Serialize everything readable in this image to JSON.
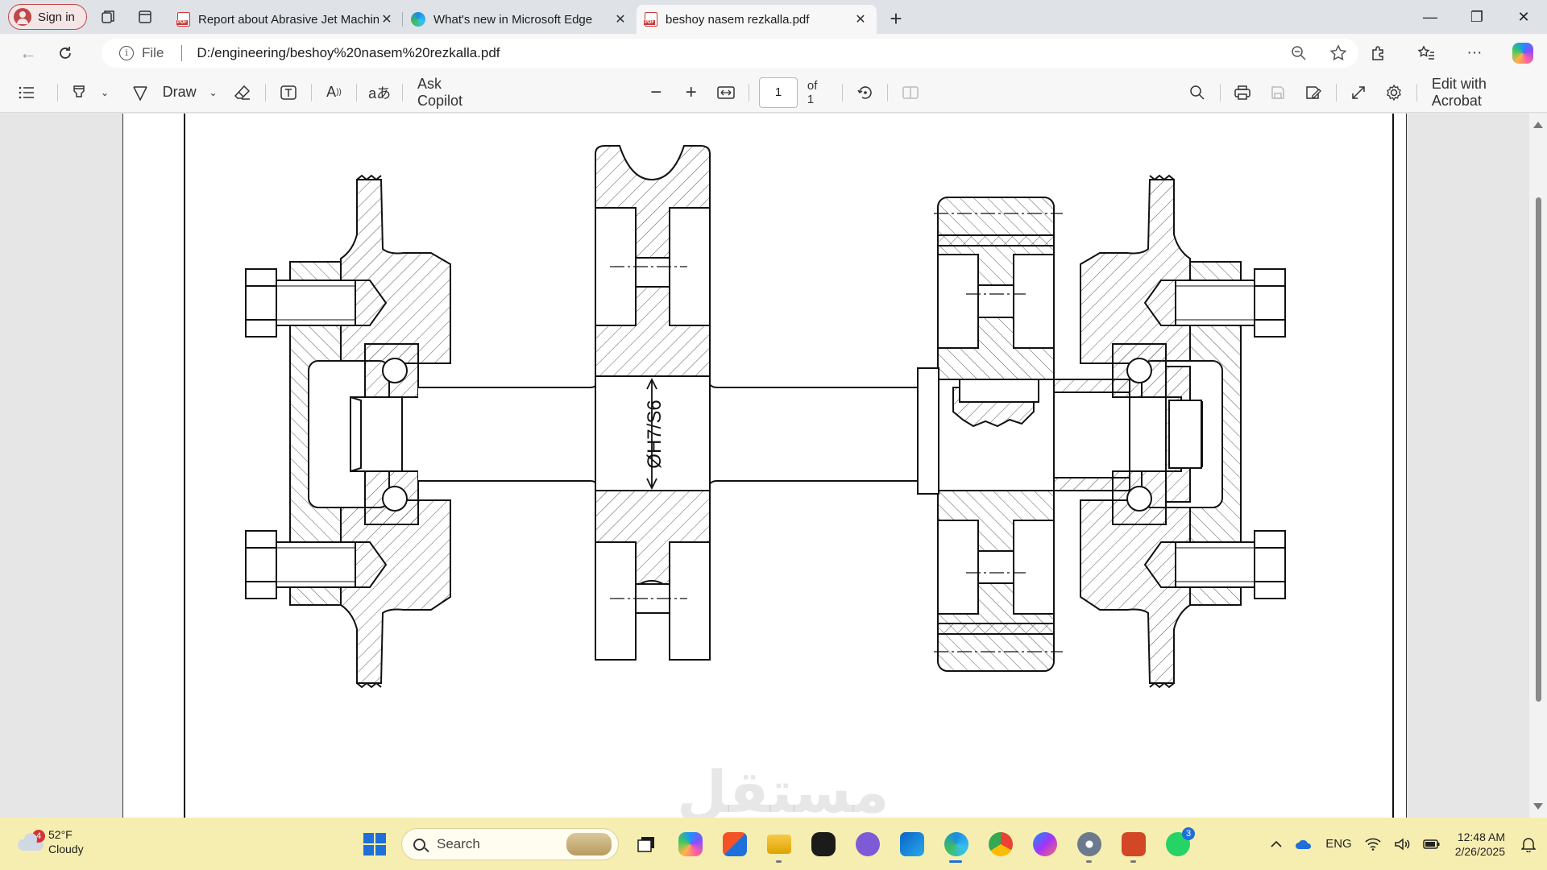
{
  "browser": {
    "sign_in": "Sign in",
    "tabs": [
      {
        "title": "Report about Abrasive Jet Machin",
        "icon": "pdf-icon"
      },
      {
        "title": "What's new in Microsoft Edge",
        "icon": "edge-icon"
      },
      {
        "title": "beshoy nasem rezkalla.pdf",
        "icon": "pdf-icon",
        "active": true
      }
    ],
    "address": {
      "scheme": "File",
      "url": "D:/engineering/beshoy%20nasem%20rezkalla.pdf"
    }
  },
  "pdf_toolbar": {
    "draw": "Draw",
    "ask_copilot": "Ask Copilot",
    "page_number": "1",
    "page_total": "of 1",
    "edit": "Edit with Acrobat"
  },
  "document": {
    "fit_label": "ØH7/S6",
    "watermark": "مستقل"
  },
  "taskbar": {
    "weather_temp": "52°F",
    "weather_cond": "Cloudy",
    "weather_badge": "4",
    "search": "Search",
    "whatsapp_badge": "3",
    "language": "ENG",
    "time": "12:48 AM",
    "date": "2/26/2025"
  },
  "colors": {
    "tab_strip": "#dfe3e7",
    "taskbar": "#f6eeb0",
    "accent": "#1e6fd9",
    "sign_in": "#c04848"
  }
}
